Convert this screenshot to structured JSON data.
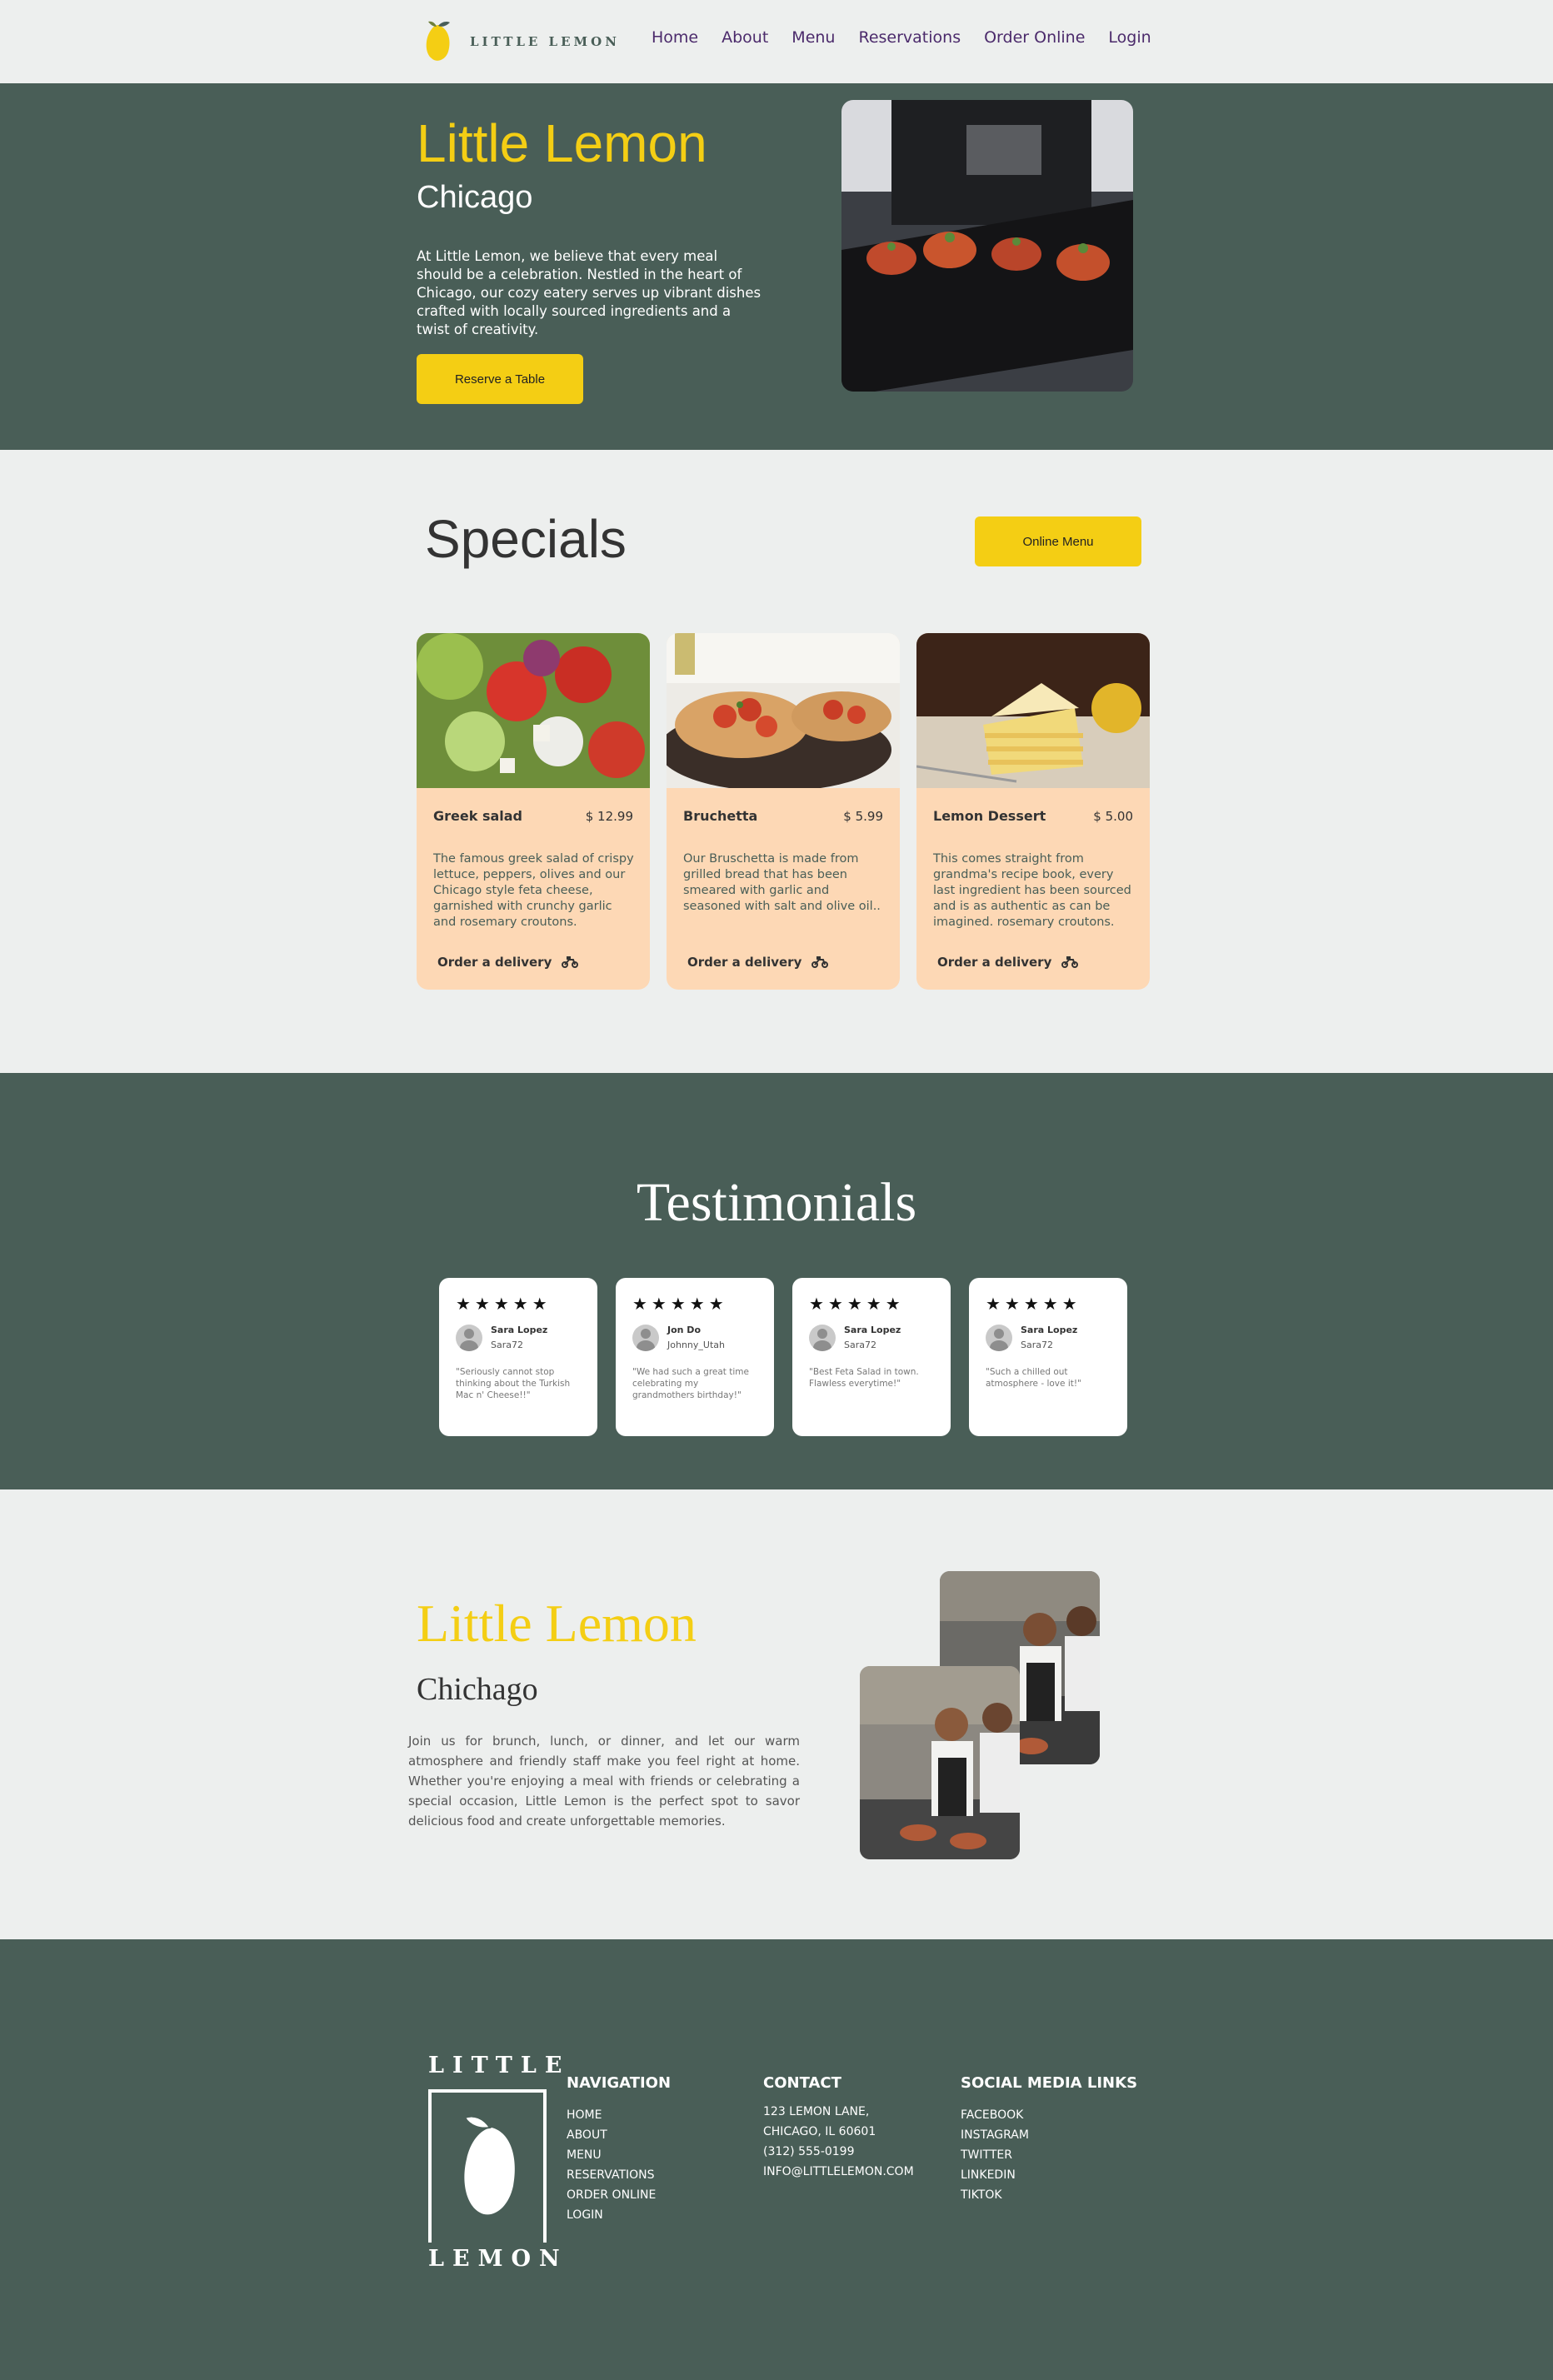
{
  "nav": {
    "logo_text": "LITTLE LEMON",
    "links": [
      "Home",
      "About",
      "Menu",
      "Reservations",
      "Order Online",
      "Login"
    ]
  },
  "hero": {
    "title": "Little Lemon",
    "subtitle": "Chicago",
    "description": "At Little Lemon, we believe that every meal should be a celebration. Nestled in the heart of Chicago, our cozy eatery serves up vibrant dishes crafted with locally sourced ingredients and a twist of creativity.",
    "button": "Reserve a Table"
  },
  "specials": {
    "title": "Specials",
    "menu_button": "Online Menu",
    "items": [
      {
        "name": "Greek salad",
        "price": "$ 12.99",
        "description": "The famous greek salad of crispy lettuce, peppers, olives and our Chicago style feta cheese, garnished with crunchy garlic and rosemary croutons.",
        "order": "Order a delivery"
      },
      {
        "name": "Bruchetta",
        "price": "$ 5.99",
        "description": "Our Bruschetta is made from grilled bread that has been smeared with garlic and seasoned with salt and olive oil..",
        "order": "Order a delivery"
      },
      {
        "name": "Lemon Dessert",
        "price": "$ 5.00",
        "description": "This comes straight from grandma's recipe book, every last ingredient has been sourced and is as authentic as can be imagined. rosemary croutons.",
        "order": "Order a delivery"
      }
    ]
  },
  "testimonials": {
    "title": "Testimonials",
    "items": [
      {
        "stars": "★★★★★",
        "rating": 5,
        "name": "Sara Lopez",
        "handle": "Sara72",
        "quote": "\"Seriously cannot stop thinking about the Turkish Mac n' Cheese!!\""
      },
      {
        "stars": "★★★★★",
        "rating": 5,
        "name": "Jon Do",
        "handle": "Johnny_Utah",
        "quote": "\"We had such a great time celebrating my grandmothers birthday!\""
      },
      {
        "stars": "★★★★★",
        "rating": 5,
        "name": "Sara Lopez",
        "handle": "Sara72",
        "quote": "\"Best Feta Salad in town. Flawless everytime!\""
      },
      {
        "stars": "★★★★★",
        "rating": 5,
        "name": "Sara Lopez",
        "handle": "Sara72",
        "quote": "\"Such a chilled out atmosphere - love it!\""
      }
    ]
  },
  "about": {
    "title": "Little Lemon",
    "subtitle": "Chichago",
    "text": "Join us for brunch, lunch, or dinner, and let our warm atmosphere and friendly staff make you feel right at home. Whether you're enjoying a meal with friends or celebrating a special occasion, Little Lemon is the perfect spot to savor delicious food and create unforgettable memories."
  },
  "footer": {
    "logo_top": "LITTLE",
    "logo_bottom": "LEMON",
    "navigation": {
      "heading": "NAVIGATION",
      "links": [
        "HOME",
        "ABOUT",
        "MENU",
        "RESERVATIONS",
        "ORDER ONLINE",
        "LOGIN"
      ]
    },
    "contact": {
      "heading": "CONTACT",
      "lines": [
        "123 LEMON LANE,",
        "CHICAGO, IL 60601",
        "(312) 555-0199",
        "INFO@LITTLELEMON.COM"
      ]
    },
    "social": {
      "heading": "SOCIAL MEDIA LINKS",
      "links": [
        "FACEBOOK",
        "INSTAGRAM",
        "TWITTER",
        "LINKEDIN",
        "TIKTOK"
      ]
    }
  },
  "colors": {
    "primary_green": "#495E57",
    "primary_yellow": "#F4CE14",
    "card_peach": "#FDD8B5",
    "background": "#EDEFEE",
    "nav_link": "#4B2A6B"
  },
  "icons": {
    "logo": "lemon-icon",
    "order": "delivery-bike-icon",
    "avatar": "user-avatar-icon"
  }
}
